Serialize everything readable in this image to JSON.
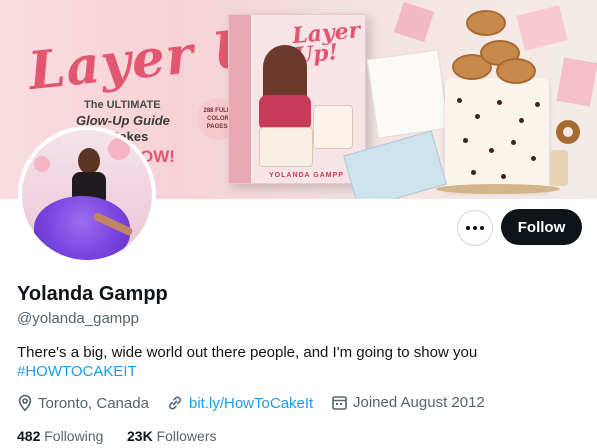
{
  "banner": {
    "title": "Layer Up!",
    "subtitle_line1": "The ULTIMATE",
    "subtitle_line2": "Glow-Up Guide",
    "subtitle_line3": "Cakes",
    "tagline": "OW!",
    "badge": "288 FULL-COLOR PAGES!",
    "book_title": "Layer Up!",
    "book_author": "YOLANDA GAMPP"
  },
  "profile": {
    "display_name": "Yolanda Gampp",
    "handle": "@yolanda_gampp",
    "bio": "There's a big, wide world out there people, and I'm going to show you",
    "hashtag": "#HOWTOCAKEIT",
    "location": "Toronto, Canada",
    "link": "bit.ly/HowToCakeIt",
    "joined": "Joined August 2012",
    "following_count": "482",
    "following_label": "Following",
    "followers_count": "23K",
    "followers_label": "Followers"
  },
  "actions": {
    "follow_label": "Follow"
  },
  "icons": {
    "more": "more-horizontal-icon",
    "location": "location-pin-icon",
    "link": "link-icon",
    "calendar": "calendar-icon"
  },
  "colors": {
    "accent": "#1d9bf0",
    "follow_button": "#0f1419",
    "secondary_text": "#536471",
    "banner_pink": "#e3566f"
  }
}
